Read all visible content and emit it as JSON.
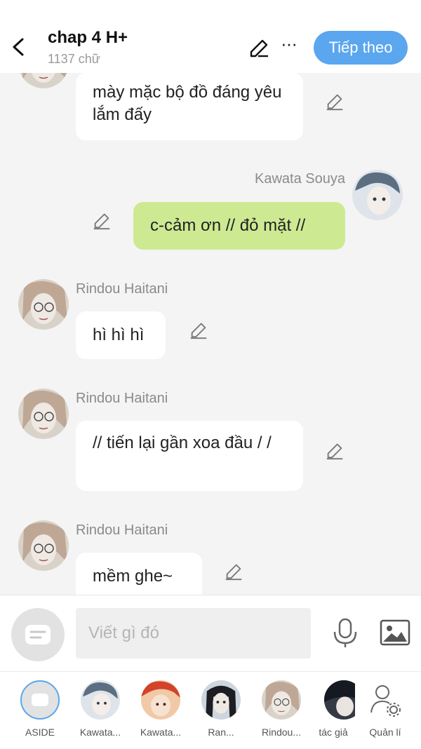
{
  "header": {
    "title": "chap 4 H+",
    "word_count": "1137 chữ",
    "next_label": "Tiếp theo",
    "more_label": "···"
  },
  "messages": [
    {
      "sender": "",
      "text": "mày mặc bộ đồ đáng yêu lắm đấy",
      "side": "left"
    },
    {
      "sender": "Kawata Souya",
      "text": "c-cảm ơn // đỏ mặt //",
      "side": "right"
    },
    {
      "sender": "Rindou Haitani",
      "text": "hì hì hì",
      "side": "left"
    },
    {
      "sender": "Rindou Haitani",
      "text": "// tiến lại gần xoa đầu / /",
      "side": "left"
    },
    {
      "sender": "Rindou Haitani",
      "text": "mềm ghe~",
      "side": "left"
    }
  ],
  "composer": {
    "placeholder": "Viết gì đó"
  },
  "characters": [
    {
      "label": "ASIDE"
    },
    {
      "label": "Kawata..."
    },
    {
      "label": "Kawata..."
    },
    {
      "label": "Ran..."
    },
    {
      "label": "Rindou..."
    },
    {
      "label": "tác giả"
    },
    {
      "label": "Quản lí"
    }
  ],
  "colors": {
    "accent": "#5aa6ef",
    "my_bubble": "#cdea93",
    "background": "#f4f4f4"
  }
}
